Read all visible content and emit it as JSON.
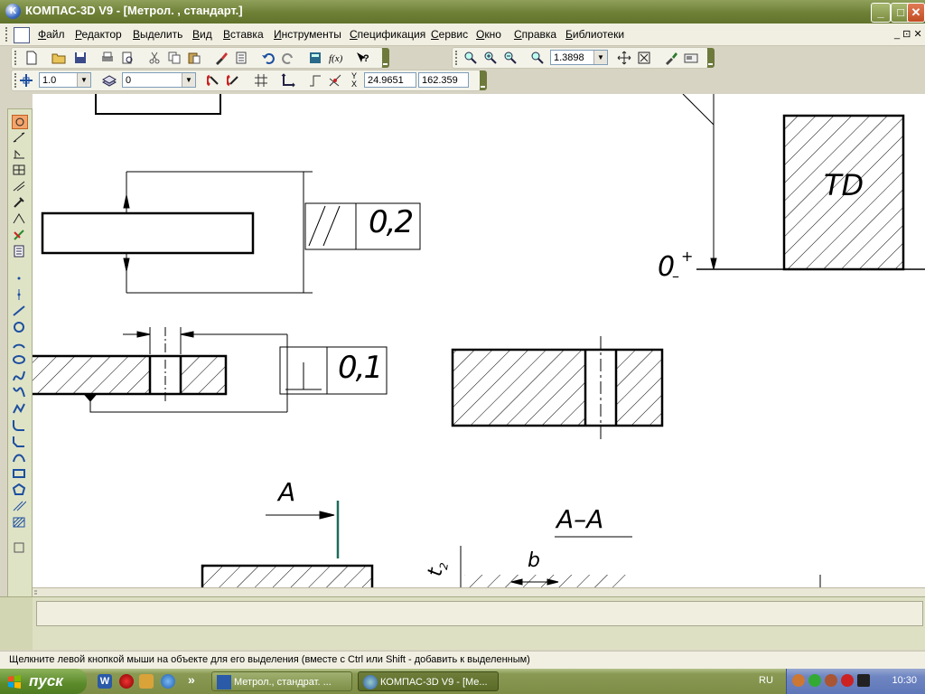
{
  "window": {
    "title": "КОМПАС-3D V9 - [Метрол. , стандарт.]",
    "app_icon_letter": "K",
    "min_glyph": "_",
    "max_glyph": "□",
    "close_glyph": "✕"
  },
  "menu": {
    "items": [
      {
        "u": "Ф",
        "rest": "айл"
      },
      {
        "u": "Р",
        "rest": "едактор"
      },
      {
        "u": "В",
        "rest": "ыделить"
      },
      {
        "u": "В",
        "rest": "ид"
      },
      {
        "u": "В",
        "rest": "ставка"
      },
      {
        "u": "И",
        "rest": "нструменты"
      },
      {
        "u": "С",
        "rest": "пецификация"
      },
      {
        "u": "С",
        "rest": "ервис"
      },
      {
        "u": "О",
        "rest": "кно"
      },
      {
        "u": "С",
        "rest": "правка"
      },
      {
        "u": "Б",
        "rest": "иблиотеки"
      }
    ],
    "mdi_controls": "_ ⊡ ✕"
  },
  "toolbar_view": {
    "zoom_value": "1.3898"
  },
  "toolbar_current": {
    "step_value": "1.0",
    "layer_value": "0",
    "coord_x": "24.9651",
    "coord_y": "162.359",
    "coord_label": "Y X"
  },
  "drawing": {
    "tol_parallel": "0,2",
    "tol_perp": "0,1",
    "td_label": "TD",
    "zero_label": "0",
    "plus_sign": "+",
    "minus_sign": "–",
    "section_letter": "A",
    "section_title": "A–A",
    "b_label": "b",
    "t2_label": "t",
    "t2_sub": "2"
  },
  "statusbar": {
    "message": "Щелкните левой кнопкой мыши на объекте для его выделения (вместе с Ctrl или Shift - добавить к выделенным)"
  },
  "taskbar": {
    "start_label": "пуск",
    "chevron": "»",
    "tasks": [
      {
        "label": "Метрол., стандрат. ..."
      },
      {
        "label": "КОМПАС-3D V9 - [Ме..."
      }
    ],
    "language": "RU",
    "clock": "10:30"
  },
  "colors": {
    "titlebar": "#6e7f36",
    "taskbar": "#7d8d46",
    "tray": "#6f86c3",
    "drawing_line": "#000000",
    "section_marker": "#1e6b5a"
  }
}
